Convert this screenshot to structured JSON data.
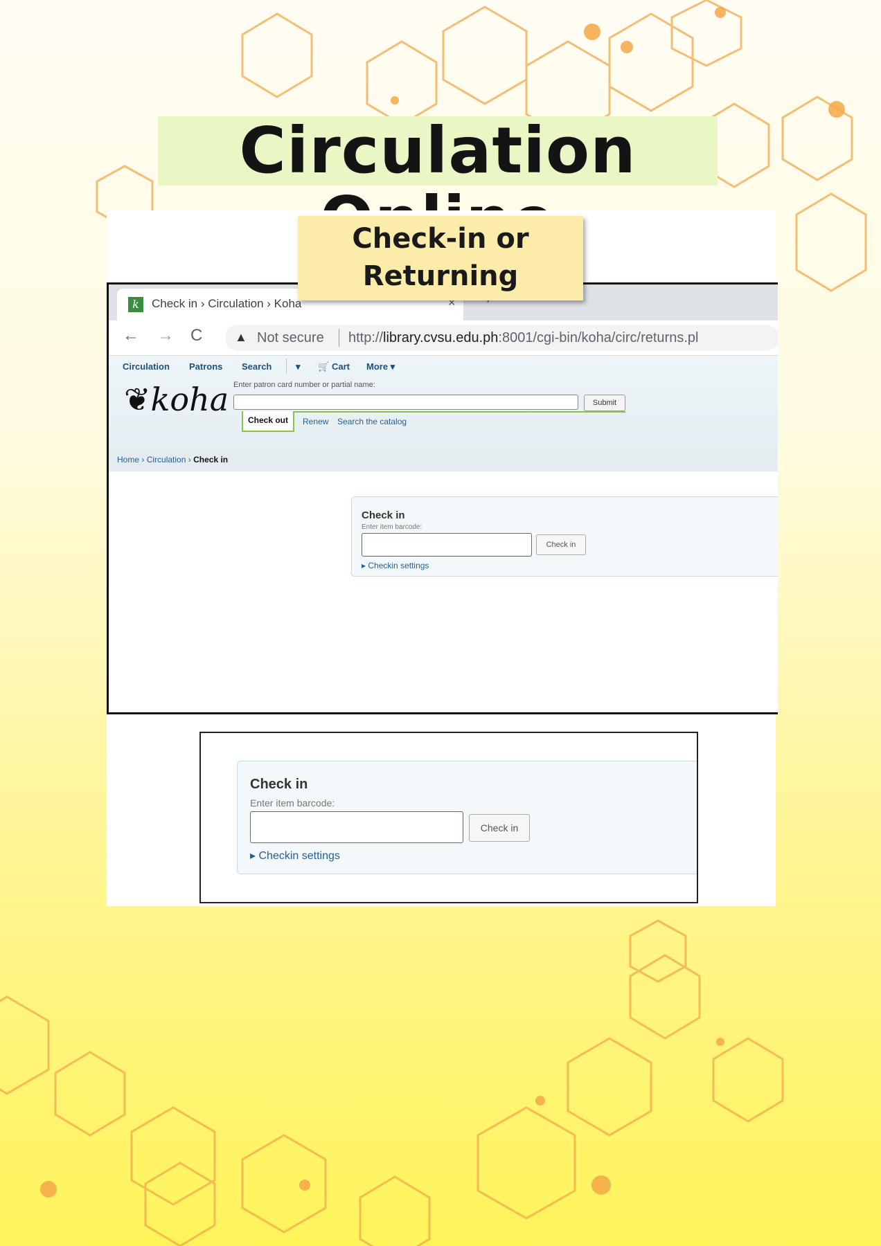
{
  "poster": {
    "title": "Circulation Online",
    "callout_line1": "Check-in or",
    "callout_line2": "Returning"
  },
  "browser": {
    "tab_title": "Check in › Circulation › Koha",
    "tab_close": "×",
    "new_tab": "+",
    "back": "←",
    "forward": "→",
    "reload": "C",
    "security_warning": "▲",
    "security_text": "Not secure",
    "url_prefix": "http://",
    "url_host": "library.cvsu.edu.ph",
    "url_rest": ":8001/cgi-bin/koha/circ/returns.pl"
  },
  "koha": {
    "menu": {
      "circulation": "Circulation",
      "patrons": "Patrons",
      "search": "Search",
      "search_dropdown": "▾",
      "cart": "Cart",
      "more": "More ▾"
    },
    "logo": "koha",
    "patron_search_label": "Enter patron card number or partial name:",
    "submit": "Submit",
    "tabs": {
      "checkout": "Check out",
      "renew": "Renew",
      "search_catalog": "Search the catalog"
    },
    "breadcrumb": {
      "home": "Home",
      "circulation": "Circulation",
      "current": "Check in",
      "separator": "›"
    }
  },
  "checkin": {
    "title": "Check in",
    "barcode_label": "Enter item barcode:",
    "button": "Check in",
    "settings_link": "Checkin settings",
    "settings_toggle": "▸"
  },
  "colors": {
    "accent_green": "#8bc24c",
    "link_blue": "#1f5f9a",
    "callout_bg": "#fbeca9",
    "title_bg": "#e9f7c4",
    "hex_orange": "#f4a748"
  }
}
